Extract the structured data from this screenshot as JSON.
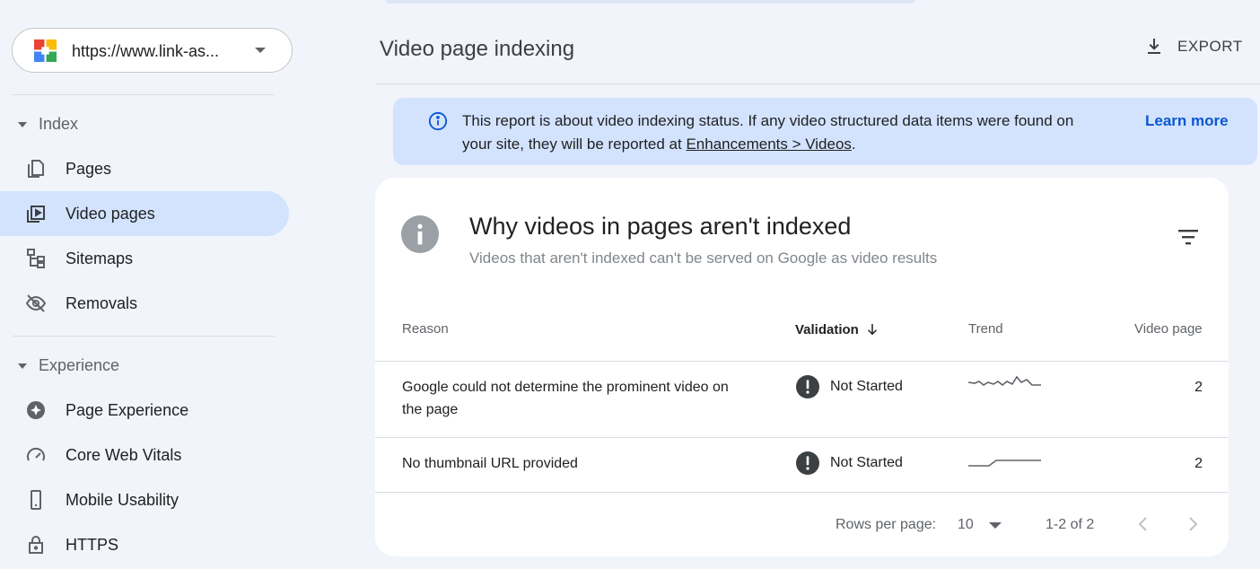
{
  "sidebar": {
    "property_url": "https://www.link-as...",
    "sections": [
      {
        "label": "Index",
        "items": [
          {
            "label": "Pages",
            "icon": "pages-icon"
          },
          {
            "label": "Video pages",
            "icon": "video-pages-icon",
            "active": true
          },
          {
            "label": "Sitemaps",
            "icon": "sitemaps-icon"
          },
          {
            "label": "Removals",
            "icon": "removals-icon"
          }
        ]
      },
      {
        "label": "Experience",
        "items": [
          {
            "label": "Page Experience",
            "icon": "page-experience-icon"
          },
          {
            "label": "Core Web Vitals",
            "icon": "core-web-vitals-icon"
          },
          {
            "label": "Mobile Usability",
            "icon": "mobile-usability-icon"
          },
          {
            "label": "HTTPS",
            "icon": "https-lock-icon"
          }
        ]
      }
    ]
  },
  "header": {
    "title": "Video page indexing",
    "export_label": "EXPORT"
  },
  "banner": {
    "text_before": "This report is about video indexing status. If any video structured data items were found on your site, they will be reported at ",
    "link_text": "Enhancements > Videos",
    "text_after": ".",
    "learn_more": "Learn more"
  },
  "card": {
    "title": "Why videos in pages aren't indexed",
    "subtitle": "Videos that aren't indexed can't be served on Google as video results",
    "columns": {
      "reason": "Reason",
      "validation": "Validation",
      "trend": "Trend",
      "video_page": "Video page"
    },
    "rows": [
      {
        "reason": "Google could not determine the prominent video on the page",
        "validation": "Not Started",
        "count": "2"
      },
      {
        "reason": "No thumbnail URL provided",
        "validation": "Not Started",
        "count": "2"
      }
    ],
    "footer": {
      "rows_per_page_label": "Rows per page:",
      "rows_per_page_value": "10",
      "range": "1-2 of 2"
    }
  },
  "colors": {
    "active_nav": "#d3e3fd",
    "banner_bg": "#d3e3fd",
    "link_blue": "#0b57d0",
    "page_bg": "#f1f4fa"
  }
}
